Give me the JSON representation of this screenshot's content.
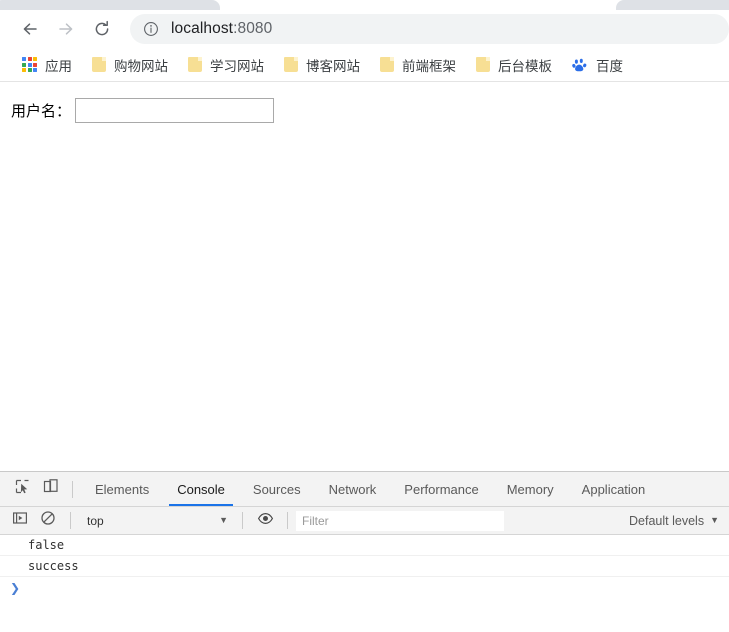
{
  "browser": {
    "nav": {
      "back_icon": "arrow-left-icon",
      "forward_icon": "arrow-right-icon",
      "reload_icon": "reload-icon"
    },
    "omnibox": {
      "info_icon": "info-circle-icon",
      "url_host": "localhost",
      "url_rest": ":8080",
      "full_url": "localhost:8080"
    },
    "bookmarks": [
      {
        "icon": "apps-grid-icon",
        "label": "应用"
      },
      {
        "icon": "folder-icon",
        "label": "购物网站"
      },
      {
        "icon": "folder-icon",
        "label": "学习网站"
      },
      {
        "icon": "folder-icon",
        "label": "博客网站"
      },
      {
        "icon": "folder-icon",
        "label": "前端框架"
      },
      {
        "icon": "folder-icon",
        "label": "后台模板"
      },
      {
        "icon": "baidu-paw-icon",
        "label": "百度"
      }
    ]
  },
  "page": {
    "form": {
      "username_label": "用户名：",
      "username_value": "",
      "username_placeholder": ""
    }
  },
  "devtools": {
    "tools": {
      "inspect_icon": "inspect-element-icon",
      "device_icon": "device-toolbar-icon"
    },
    "tabs": [
      {
        "label": "Elements",
        "active": false
      },
      {
        "label": "Console",
        "active": true
      },
      {
        "label": "Sources",
        "active": false
      },
      {
        "label": "Network",
        "active": false
      },
      {
        "label": "Performance",
        "active": false
      },
      {
        "label": "Memory",
        "active": false
      },
      {
        "label": "Application",
        "active": false
      }
    ],
    "console_toolbar": {
      "execute_icon": "execute-sidebar-icon",
      "clear_icon": "clear-console-icon",
      "context": "top",
      "eye_icon": "live-expression-eye-icon",
      "filter_placeholder": "Filter",
      "filter_value": "",
      "levels_label": "Default levels",
      "caret": "▼"
    },
    "console_messages": [
      {
        "text": "false"
      },
      {
        "text": "success"
      }
    ],
    "prompt_symbol": "❯"
  },
  "colors": {
    "accent": "#1a73e8",
    "omnibox_bg": "#f1f3f4",
    "devtools_bg": "#f3f3f3",
    "folder": "#f7df94",
    "prompt": "#4a7fd4"
  }
}
